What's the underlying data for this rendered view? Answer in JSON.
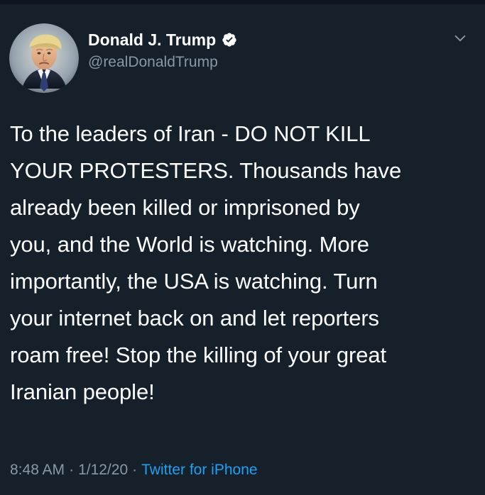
{
  "tweet": {
    "author": {
      "display_name": "Donald J. Trump",
      "handle": "@realDonaldTrump",
      "verified": true,
      "avatar_icon": "profile-photo"
    },
    "text_lines": [
      "To the leaders of Iran - DO NOT KILL",
      "YOUR PROTESTERS. Thousands have",
      "already been killed or imprisoned by",
      "you, and the World is watching. More",
      "importantly, the USA is watching. Turn",
      "your internet back on and let reporters",
      "roam free! Stop the killing of your great",
      "Iranian people!"
    ],
    "time": "8:48 AM",
    "date": "1/12/20",
    "separator": "·",
    "source": "Twitter for iPhone"
  },
  "colors": {
    "background": "#15202b",
    "text_primary": "#ffffff",
    "text_secondary": "#8899a6",
    "accent": "#1da1f2"
  },
  "icons": {
    "verified_badge": "verified-badge-icon",
    "menu": "chevron-down-icon"
  }
}
